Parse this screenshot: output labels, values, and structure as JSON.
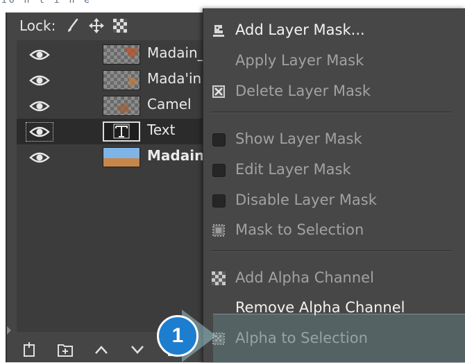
{
  "top_strip": {
    "cut_text": "io n t i n e"
  },
  "layers_panel": {
    "lock_label": "Lock:",
    "lock_icons": [
      "paintbrush-icon",
      "move-icon",
      "alpha-checker-icon"
    ],
    "layers": [
      {
        "name": "Madain_",
        "thumb": "checker-sprite",
        "bold": false,
        "selected": false
      },
      {
        "name": "Mada'in",
        "thumb": "checker-sprite",
        "bold": false,
        "selected": false
      },
      {
        "name": "Camel",
        "thumb": "checker-sprite",
        "bold": false,
        "selected": false
      },
      {
        "name": "Text",
        "thumb": "text-layer",
        "bold": false,
        "selected": true
      },
      {
        "name": "Madain",
        "thumb": "photo",
        "bold": true,
        "selected": false
      }
    ],
    "toolbar": [
      "new-layer-icon",
      "new-group-icon",
      "raise-layer-icon",
      "lower-layer-icon",
      "duplicate-layer-icon"
    ]
  },
  "context_menu": {
    "items": [
      {
        "label": "Add Layer Mask...",
        "enabled": true,
        "icon": "add-mask-icon"
      },
      {
        "label": "Apply Layer Mask",
        "enabled": false,
        "icon": ""
      },
      {
        "label": "Delete Layer Mask",
        "enabled": false,
        "icon": "delete-mask-icon"
      },
      {
        "label": "Show Layer Mask",
        "enabled": false,
        "icon": "checkbox-icon"
      },
      {
        "label": "Edit Layer Mask",
        "enabled": false,
        "icon": "checkbox-icon"
      },
      {
        "label": "Disable Layer Mask",
        "enabled": false,
        "icon": "checkbox-icon"
      },
      {
        "label": "Mask to Selection",
        "enabled": false,
        "icon": "mask-selection-icon"
      },
      {
        "label": "Add Alpha Channel",
        "enabled": false,
        "icon": "alpha-checker-icon"
      },
      {
        "label": "Remove Alpha Channel",
        "enabled": true,
        "icon": ""
      },
      {
        "label": "Alpha to Selection",
        "enabled": false,
        "icon": "alpha-selection-icon"
      }
    ]
  },
  "callout": {
    "number": "1",
    "color": "#1d7ed0"
  }
}
